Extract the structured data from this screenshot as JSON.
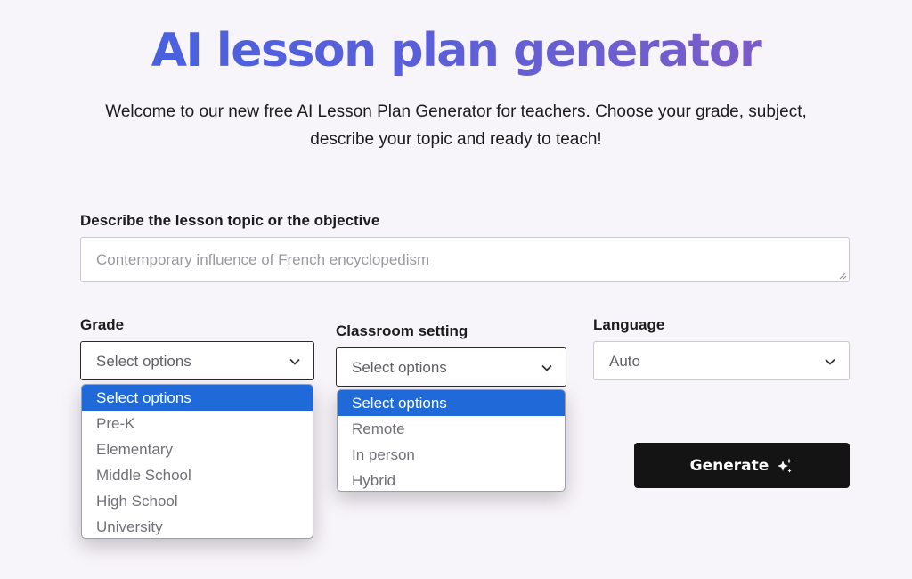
{
  "header": {
    "title": "AI lesson plan generator",
    "subtitle": "Welcome to our new free AI Lesson Plan Generator for teachers. Choose your grade, subject, describe your topic and ready to teach!"
  },
  "topic": {
    "label": "Describe the lesson topic or the objective",
    "placeholder": "Contemporary influence of French encyclopedism"
  },
  "grade": {
    "label": "Grade",
    "value": "Select options",
    "options": [
      "Select options",
      "Pre-K",
      "Elementary",
      "Middle School",
      "High School",
      "University"
    ]
  },
  "classroom": {
    "label": "Classroom setting",
    "value": "Select options",
    "options": [
      "Select options",
      "Remote",
      "In person",
      "Hybrid"
    ]
  },
  "language": {
    "label": "Language",
    "value": "Auto"
  },
  "generate": {
    "label": "Generate"
  },
  "colors": {
    "title_gradient": [
      "#3f62e3",
      "#8a5bbf"
    ],
    "selected_option": "#1f6ad8",
    "button": "#141414"
  },
  "icons": {
    "select_chevron": "chevron-down-icon",
    "generate": "sparkle-icon"
  }
}
